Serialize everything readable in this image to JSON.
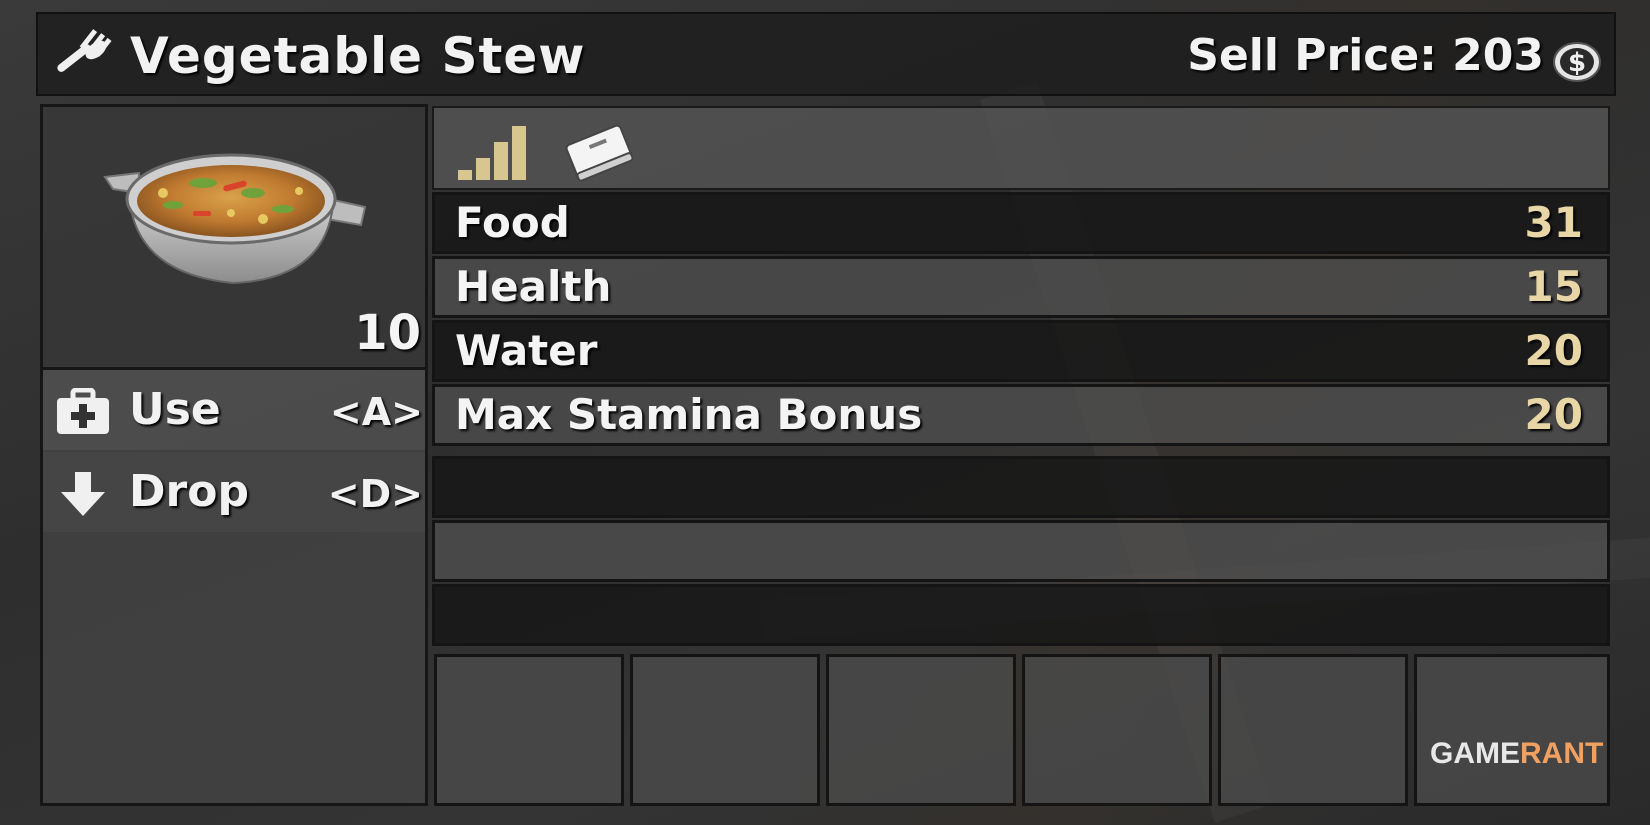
{
  "header": {
    "title": "Vegetable Stew",
    "sell_price_label": "Sell Price: 203",
    "utensil_icon": "fork-icon",
    "currency_icon": "dollar-coin-icon"
  },
  "item": {
    "image_icon": "stew-pot-icon",
    "count": "10"
  },
  "actions": [
    {
      "label": "Use",
      "key": "<A>",
      "icon": "first-aid-kit-icon"
    },
    {
      "label": "Drop",
      "key": "<D>",
      "icon": "down-arrow-icon"
    }
  ],
  "icon_bar": {
    "icons": [
      "quality-bars-icon",
      "book-icon"
    ]
  },
  "stats": [
    {
      "name": "Food",
      "value": "31"
    },
    {
      "name": "Health",
      "value": "15"
    },
    {
      "name": "Water",
      "value": "20"
    },
    {
      "name": "Max Stamina Bonus",
      "value": "20"
    }
  ],
  "watermark": {
    "part1": "GAME",
    "part2": "RANT"
  },
  "colors": {
    "stat_value": "#e8d6a6",
    "text": "#f2f2f2",
    "watermark_accent": "#f0a060"
  }
}
